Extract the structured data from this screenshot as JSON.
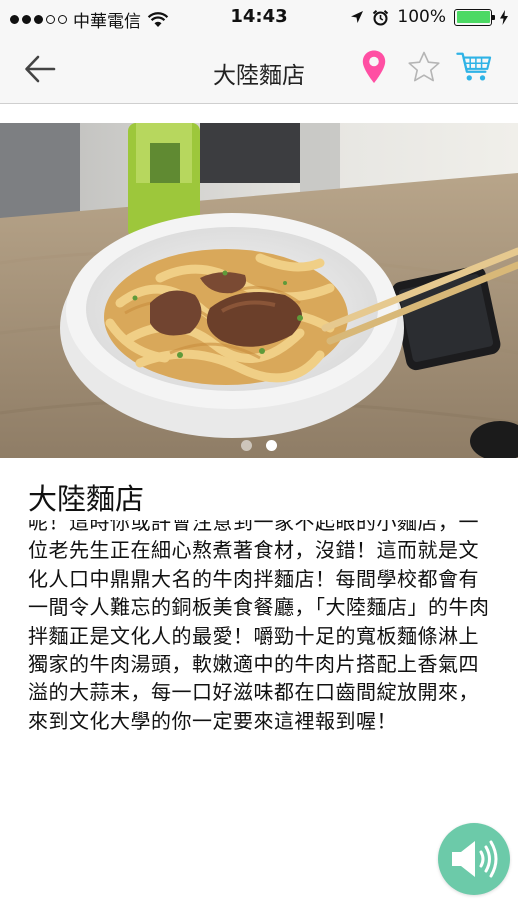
{
  "status_bar": {
    "carrier": "中華電信",
    "time": "14:43",
    "battery": "100%",
    "battery_level": 1.0,
    "signal_bars": 3,
    "signal_total": 5
  },
  "nav": {
    "title": "大陸麵店",
    "back_icon": "back-arrow-icon",
    "location_icon": "map-pin-icon",
    "favorite_icon": "star-icon",
    "cart_icon": "shopping-cart-icon"
  },
  "photo": {
    "pages": 2,
    "current_page": 2
  },
  "detail": {
    "name": "大陸麵店",
    "description": "呢！這時你或許會注意到一家不起眼的小麵店，一位老先生正在細心熬煮著食材，沒錯！這而就是文化人口中鼎鼎大名的牛肉拌麵店！每間學校都會有一間令人難忘的銅板美食餐廳，「大陸麵店」的牛肉拌麵正是文化人的最愛！嚼勁十足的寬板麵條淋上獨家的牛肉湯頭，軟嫩適中的牛肉片搭配上香氣四溢的大蒜末，每一口好滋味都在口齒間綻放開來，來到文化大學的你一定要來這裡報到喔！"
  },
  "audio_button": {
    "icon": "speaker-icon"
  },
  "colors": {
    "pin": "#ff4fa3",
    "cart": "#2fb3e6",
    "star_outline": "#b5b5b5",
    "fab": "#6ccaa9",
    "battery": "#4cd964"
  }
}
